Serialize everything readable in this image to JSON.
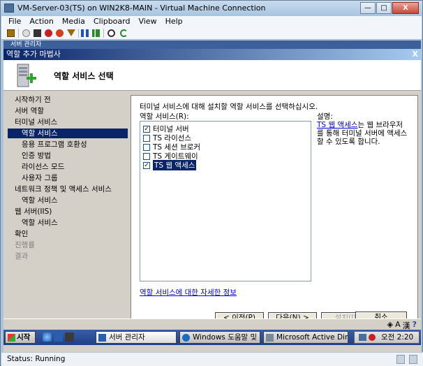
{
  "host": {
    "title": "VM-Server-03(TS) on WIN2K8-MAIN - Virtual Machine Connection",
    "buttons": {
      "minimize": "—",
      "maximize": "□",
      "close": "X"
    },
    "menu": [
      "File",
      "Action",
      "Media",
      "Clipboard",
      "View",
      "Help"
    ]
  },
  "remote": {
    "strip_text": "서버 관리자",
    "wizard_title": "역할 추가 마법사",
    "wizard_close": "X",
    "page_title": "역할 서비스 선택",
    "steps": [
      {
        "label": "시작하기 전",
        "level": 0,
        "state": "normal"
      },
      {
        "label": "서버 역할",
        "level": 0,
        "state": "normal"
      },
      {
        "label": "터미널 서비스",
        "level": 0,
        "state": "normal"
      },
      {
        "label": "역할 서비스",
        "level": 1,
        "state": "active"
      },
      {
        "label": "응용 프로그램 호환성",
        "level": 1,
        "state": "normal"
      },
      {
        "label": "인증 방법",
        "level": 1,
        "state": "normal"
      },
      {
        "label": "라이선스 모드",
        "level": 1,
        "state": "normal"
      },
      {
        "label": "사용자 그룹",
        "level": 1,
        "state": "normal"
      },
      {
        "label": "네트워크 정책 및 액세스 서비스",
        "level": 0,
        "state": "normal"
      },
      {
        "label": "역할 서비스",
        "level": 1,
        "state": "normal"
      },
      {
        "label": "웹 서버(IIS)",
        "level": 0,
        "state": "normal"
      },
      {
        "label": "역할 서비스",
        "level": 1,
        "state": "normal"
      },
      {
        "label": "확인",
        "level": 0,
        "state": "normal"
      },
      {
        "label": "진행률",
        "level": 0,
        "state": "disabled"
      },
      {
        "label": "결과",
        "level": 0,
        "state": "disabled"
      }
    ],
    "description": "터미널 서비스에 대해 설치할 역할 서비스를 선택하십시오.",
    "role_services_label": "역할 서비스(R):",
    "role_services": [
      {
        "label": "터미널 서버",
        "checked": true,
        "selected": false
      },
      {
        "label": "TS 라이선스",
        "checked": false,
        "selected": false
      },
      {
        "label": "TS 세션 브로커",
        "checked": false,
        "selected": false
      },
      {
        "label": "TS 게이트웨이",
        "checked": false,
        "selected": false
      },
      {
        "label": "TS 웹 액세스",
        "checked": true,
        "selected": true
      }
    ],
    "note_heading": "설명:",
    "note_link": "TS 웹 액세스",
    "note_text": "는 웹 브라우저를 통해 터미널 서버에 액세스할 수 있도록 합니다.",
    "more_info_link": "역할 서비스에 대한 자세한 정보",
    "buttons": {
      "prev": "< 이전(P)",
      "next": "다음(N) >",
      "install": "설치(I)",
      "cancel": "취소"
    },
    "taskbar": {
      "start": "시작",
      "tasks": [
        "서버 관리자",
        "Windows 도움말 및 ...",
        "Microsoft Active Dire..."
      ],
      "clock": "오전 2:20"
    },
    "lang_bar": [
      "A",
      "漢"
    ]
  },
  "status": "Status: Running",
  "colors": {
    "accent": "#0a246a",
    "link": "#0000cc",
    "wizard_bg": "#d4d0c8"
  }
}
